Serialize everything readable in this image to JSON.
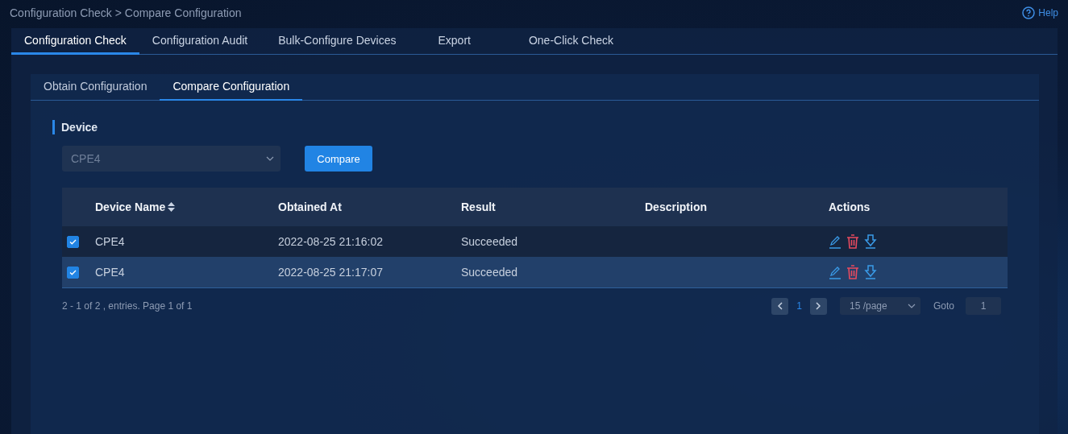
{
  "breadcrumb": "Configuration Check > Compare Configuration",
  "help": "Help",
  "tabs": [
    {
      "label": "Configuration Check",
      "selected": true
    },
    {
      "label": "Configuration Audit",
      "selected": false
    },
    {
      "label": "Bulk-Configure Devices",
      "selected": false
    },
    {
      "label": "Export",
      "selected": false
    },
    {
      "label": "One-Click Check",
      "selected": false
    }
  ],
  "subtabs": [
    {
      "label": "Obtain Configuration",
      "selected": false
    },
    {
      "label": "Compare Configuration",
      "selected": true
    }
  ],
  "section_title": "Device",
  "device_select": {
    "value": "CPE4"
  },
  "compare_button": "Compare",
  "table": {
    "columns": [
      {
        "label": "Device Name",
        "sortable": true
      },
      {
        "label": "Obtained At",
        "sortable": false
      },
      {
        "label": "Result",
        "sortable": false
      },
      {
        "label": "Description",
        "sortable": false
      },
      {
        "label": "Actions",
        "sortable": false
      }
    ],
    "rows": [
      {
        "checked": true,
        "highlighted": false,
        "cells": [
          "CPE4",
          "2022-08-25 21:16:02",
          "Succeeded",
          ""
        ]
      },
      {
        "checked": true,
        "highlighted": true,
        "cells": [
          "CPE4",
          "2022-08-25 21:17:07",
          "Succeeded",
          ""
        ]
      }
    ]
  },
  "pagination": {
    "summary": "2 - 1 of 2 , entries. Page 1 of 1",
    "page": "1",
    "page_size": "15 /page",
    "goto_label": "Goto",
    "goto_value": "1"
  }
}
